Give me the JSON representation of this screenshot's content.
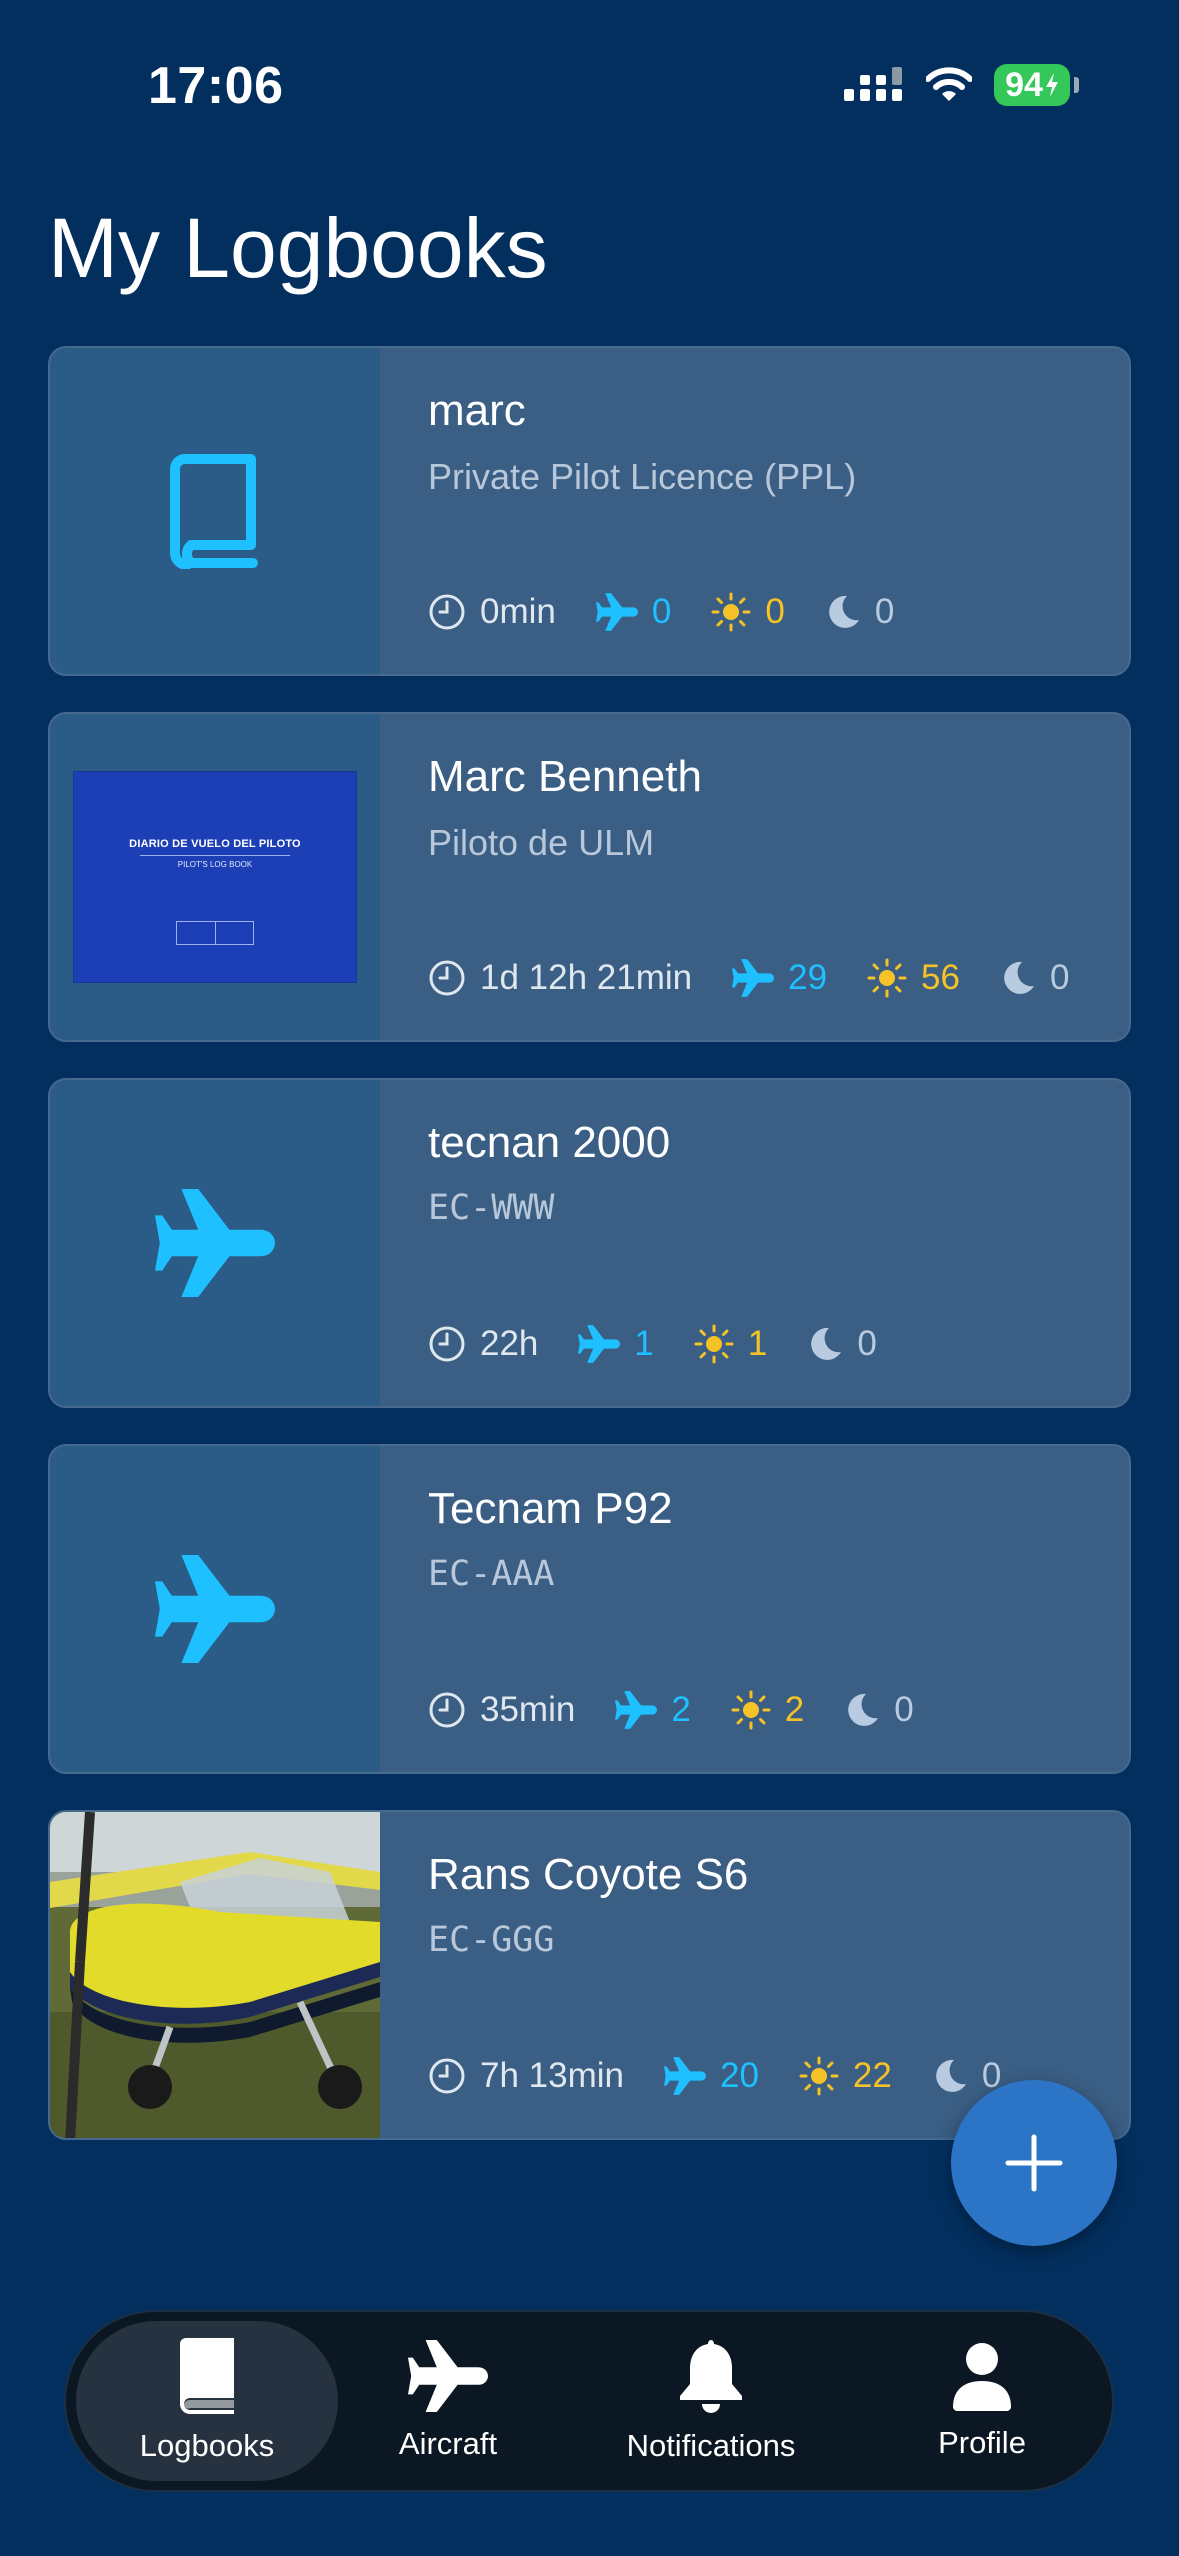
{
  "status_bar": {
    "time": "17:06",
    "battery": "94"
  },
  "page": {
    "title": "My Logbooks"
  },
  "colors": {
    "background": "#032f5f",
    "card": "#3a5e84",
    "accent_blue": "#1ec0ff",
    "day_yellow": "#f5c327",
    "fab": "#2c75c6"
  },
  "logbooks": [
    {
      "name": "marc",
      "subtitle": "Private Pilot Licence (PPL)",
      "thumb": "book-icon",
      "time": "0min",
      "flights": "0",
      "day": "0",
      "night": "0"
    },
    {
      "name": "Marc Benneth",
      "subtitle": "Piloto de ULM",
      "thumb": "logbook-cover",
      "cover_title": "DIARIO DE VUELO DEL PILOTO",
      "cover_subtitle": "PILOT'S LOG BOOK",
      "time": "1d 12h 21min",
      "flights": "29",
      "day": "56",
      "night": "0"
    },
    {
      "name": "tecnan 2000",
      "subtitle": "EC-WWW",
      "thumb": "airplane-icon",
      "time": "22h",
      "flights": "1",
      "day": "1",
      "night": "0"
    },
    {
      "name": "Tecnam P92",
      "subtitle": "EC-AAA",
      "thumb": "airplane-icon",
      "time": "35min",
      "flights": "2",
      "day": "2",
      "night": "0"
    },
    {
      "name": "Rans Coyote S6",
      "subtitle": "EC-GGG",
      "thumb": "aircraft-photo",
      "time": "7h 13min",
      "flights": "20",
      "day": "22",
      "night": "0"
    }
  ],
  "fab": {
    "icon": "plus-icon"
  },
  "tabs": [
    {
      "label": "Logbooks",
      "icon": "book-icon",
      "active": true
    },
    {
      "label": "Aircraft",
      "icon": "airplane-icon",
      "active": false
    },
    {
      "label": "Notifications",
      "icon": "bell-icon",
      "active": false
    },
    {
      "label": "Profile",
      "icon": "person-icon",
      "active": false
    }
  ]
}
